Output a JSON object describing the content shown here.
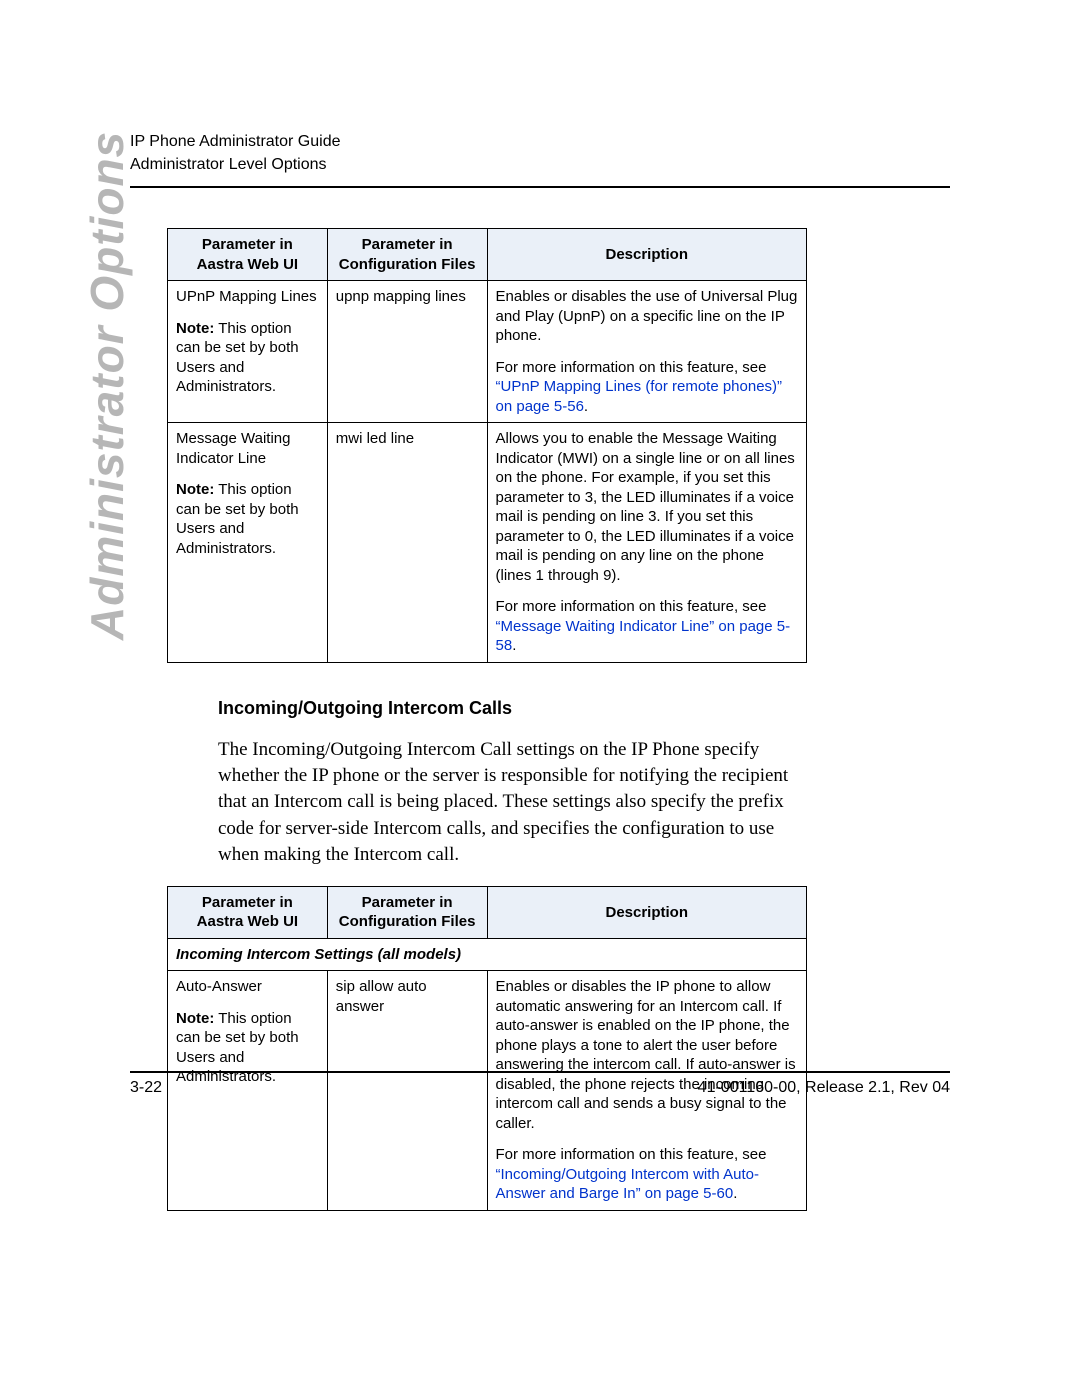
{
  "header": {
    "line1": "IP Phone Administrator Guide",
    "line2": "Administrator Level Options"
  },
  "sideLabel": "Administrator Options",
  "columns": {
    "webui": "Parameter in\nAastra Web UI",
    "cfg": "Parameter in\nConfiguration Files",
    "desc": "Description"
  },
  "note_prefix": "Note:",
  "note_body": " This option can be set by both Users and Administrators.",
  "table1": {
    "rows": [
      {
        "webui": "UPnP Mapping Lines",
        "cfg": "upnp mapping lines",
        "desc_plain": "Enables or disables the use of Universal Plug and Play (UpnP) on a specific line on the IP phone.",
        "desc_moreinfo_pre": "For more information on this feature, see ",
        "desc_link": "UPnP Mapping Lines (for remote phones)",
        "desc_on": " on ",
        "desc_page": "page 5-56",
        "desc_period": "."
      },
      {
        "webui": "Message Waiting Indicator Line",
        "cfg": "mwi led line",
        "desc_plain": "Allows you to enable the Message Waiting Indicator (MWI) on a single line or on all lines on the phone. For example, if you set this parameter to 3, the LED illuminates if a voice mail is pending on line 3. If you set this parameter to 0, the LED illuminates if a voice mail is pending on any line on the phone (lines 1 through 9).",
        "desc_moreinfo_pre": "For more information on this feature, see ",
        "desc_link": "Message Waiting Indicator Line",
        "desc_on": " on ",
        "desc_page": "page 5-58",
        "desc_period": "."
      }
    ]
  },
  "section": {
    "heading": "Incoming/Outgoing Intercom Calls",
    "para": "The Incoming/Outgoing Intercom Call settings on the IP Phone specify whether the IP phone or the server is responsible for notifying the recipient that an Intercom call is being placed. These settings also specify the prefix code for server-side Intercom calls, and specifies the configuration to use when making the Intercom call."
  },
  "table2": {
    "sectionRow": "Incoming Intercom Settings (all models)",
    "rows": [
      {
        "webui": "Auto-Answer",
        "cfg": "sip allow auto answer",
        "desc_plain": "Enables or disables the IP phone to allow automatic answering for an Intercom call. If auto-answer is enabled on the IP phone, the phone plays a tone to alert the user before answering the intercom call. If auto-answer is disabled, the phone rejects the incoming intercom call and sends a busy signal to the caller.",
        "desc_moreinfo_pre": "For more information on this feature, see ",
        "desc_link": "Incoming/Outgoing Intercom with Auto-Answer and Barge In",
        "desc_on": " on ",
        "desc_page": "page 5-60",
        "desc_period": "."
      }
    ]
  },
  "footer": {
    "left": "3-22",
    "right": "41-001160-00, Release 2.1, Rev 04"
  }
}
